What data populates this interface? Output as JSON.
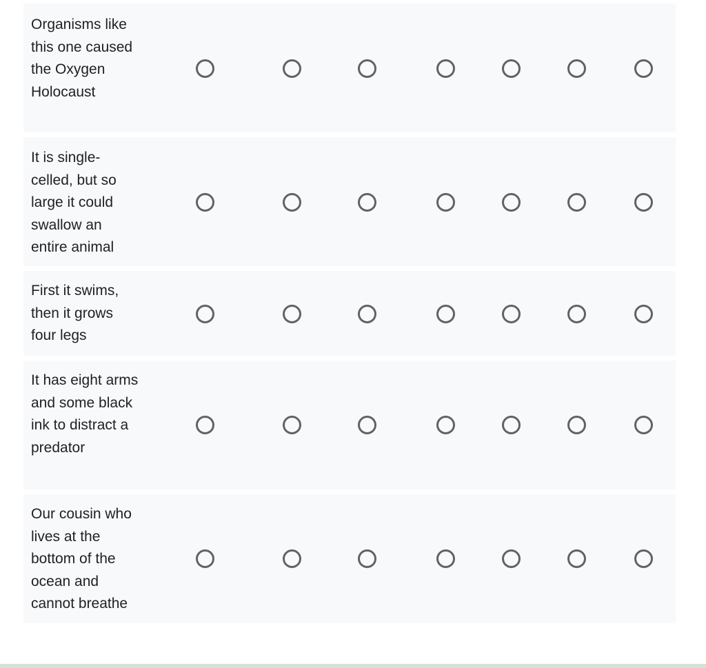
{
  "grid": {
    "columns": 7,
    "rows": [
      {
        "label": "Organisms like this one caused the Oxygen Holocaust",
        "selected": null
      },
      {
        "label": "It is single-celled, but so large it could swallow an entire animal",
        "selected": null
      },
      {
        "label": "First it swims, then it grows four legs",
        "selected": null
      },
      {
        "label": "It has eight arms and some black ink to distract a predator",
        "selected": null
      },
      {
        "label": "Our cousin who lives at the bottom of the ocean and cannot breathe",
        "selected": null
      }
    ]
  },
  "colors": {
    "row_background": "#f8f9fa",
    "radio_border": "#5f6368",
    "text": "#202124",
    "bottom_strip": "#d3e3d5"
  }
}
